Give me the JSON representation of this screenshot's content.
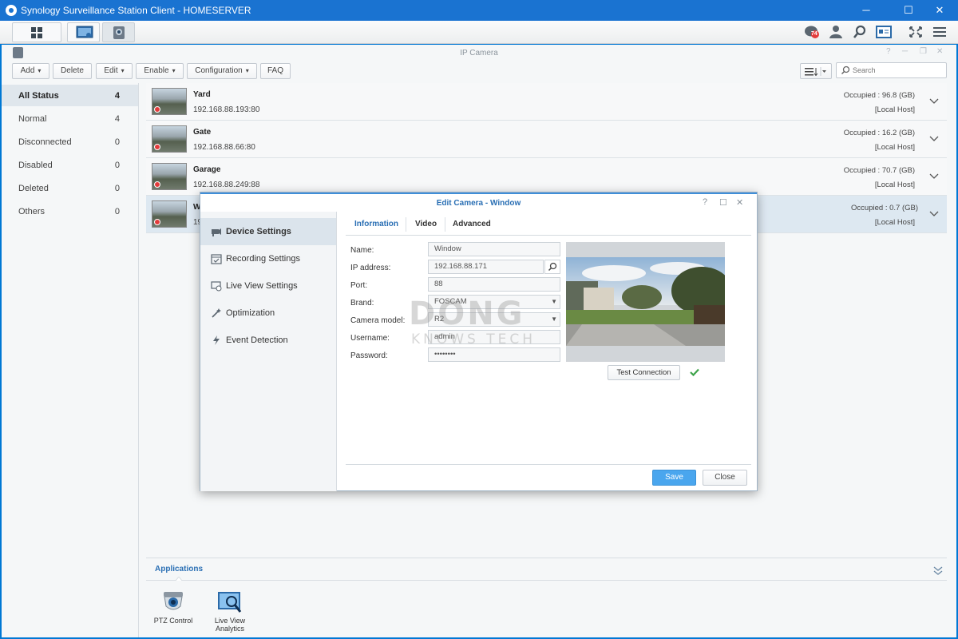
{
  "window": {
    "title": "Synology Surveillance Station Client - HOMESERVER",
    "minimize": "─",
    "maximize": "☐",
    "close": "✕"
  },
  "taskbar": {
    "notification_count": "74",
    "icons": [
      "main-menu-icon",
      "monitor-icon",
      "ip-camera-icon",
      "notification-icon",
      "user-icon",
      "search-icon",
      "id-card-icon",
      "fullscreen-icon",
      "menu-icon"
    ]
  },
  "app_window": {
    "title": "IP Camera",
    "controls": [
      "?",
      "─",
      "❐",
      "✕"
    ]
  },
  "toolbar": {
    "add": "Add",
    "delete": "Delete",
    "edit": "Edit",
    "enable": "Enable",
    "configuration": "Configuration",
    "faq": "FAQ",
    "search_placeholder": "Search"
  },
  "sidebar": {
    "items": [
      {
        "label": "All Status",
        "count": "4"
      },
      {
        "label": "Normal",
        "count": "4"
      },
      {
        "label": "Disconnected",
        "count": "0"
      },
      {
        "label": "Disabled",
        "count": "0"
      },
      {
        "label": "Deleted",
        "count": "0"
      },
      {
        "label": "Others",
        "count": "0"
      }
    ]
  },
  "cameras": [
    {
      "name": "Yard",
      "ip": "192.168.88.193:80",
      "occupied": "Occupied : 96.8 (GB)",
      "host": "[Local Host]"
    },
    {
      "name": "Gate",
      "ip": "192.168.88.66:80",
      "occupied": "Occupied : 16.2 (GB)",
      "host": "[Local Host]"
    },
    {
      "name": "Garage",
      "ip": "192.168.88.249:88",
      "occupied": "Occupied : 70.7 (GB)",
      "host": "[Local Host]"
    },
    {
      "name": "W",
      "ip": "19",
      "occupied": "Occupied : 0.7 (GB)",
      "host": "[Local Host]"
    }
  ],
  "applications": {
    "tab": "Applications",
    "items": [
      {
        "label_1": "PTZ Control",
        "label_2": ""
      },
      {
        "label_1": "Live View",
        "label_2": "Analytics"
      }
    ]
  },
  "dialog": {
    "title": "Edit Camera - Window",
    "controls": [
      "?",
      "☐",
      "✕"
    ],
    "nav": [
      {
        "label": "Device Settings",
        "icon": "camera-icon"
      },
      {
        "label": "Recording Settings",
        "icon": "calendar-icon"
      },
      {
        "label": "Live View Settings",
        "icon": "live-view-icon"
      },
      {
        "label": "Optimization",
        "icon": "wand-icon"
      },
      {
        "label": "Event Detection",
        "icon": "lightning-icon"
      }
    ],
    "tabs": [
      "Information",
      "Video",
      "Advanced"
    ],
    "fields": {
      "name_label": "Name:",
      "name_value": "Window",
      "ip_label": "IP address:",
      "ip_value": "192.168.88.171",
      "port_label": "Port:",
      "port_value": "88",
      "brand_label": "Brand:",
      "brand_value": "FOSCAM",
      "model_label": "Camera model:",
      "model_value": "R2",
      "username_label": "Username:",
      "username_value": "admin",
      "password_label": "Password:",
      "password_value": "••••••••"
    },
    "test_connection": "Test Connection",
    "save": "Save",
    "close": "Close"
  },
  "watermark": {
    "line1": "DONG",
    "line2": "KNOWS TECH"
  },
  "colors": {
    "accent": "#2a6fb4",
    "titlebar": "#1a73d1",
    "save": "#4aa6ee",
    "ok": "#3da34a",
    "rec": "#e23b3b"
  }
}
